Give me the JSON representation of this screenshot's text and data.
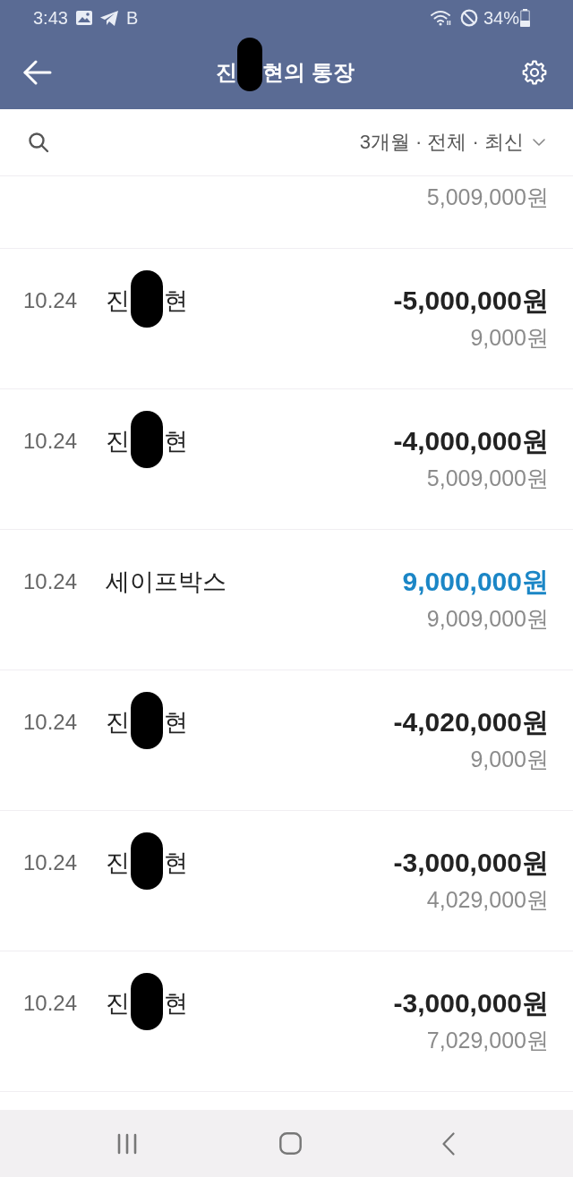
{
  "status_bar": {
    "time": "3:43",
    "notification_letter": "B",
    "battery_text": "34%"
  },
  "header": {
    "title_parts": [
      "진",
      "현의 통장"
    ]
  },
  "filter": {
    "label": "3개월 · 전체 · 최신"
  },
  "partial_row": {
    "balance": "5,009,000원"
  },
  "transactions": [
    {
      "kind": "withdrawal",
      "date": "10.24",
      "name_parts": [
        "진",
        "현"
      ],
      "amount": "-5,000,000원",
      "balance": "9,000원"
    },
    {
      "kind": "withdrawal",
      "date": "10.24",
      "name_parts": [
        "진",
        "현"
      ],
      "amount": "-4,000,000원",
      "balance": "5,009,000원"
    },
    {
      "kind": "deposit",
      "date": "10.24",
      "name_parts": [
        "세이프박스"
      ],
      "amount": "9,000,000원",
      "balance": "9,009,000원"
    },
    {
      "kind": "withdrawal",
      "date": "10.24",
      "name_parts": [
        "진",
        "현"
      ],
      "amount": "-4,020,000원",
      "balance": "9,000원"
    },
    {
      "kind": "withdrawal",
      "date": "10.24",
      "name_parts": [
        "진",
        "현"
      ],
      "amount": "-3,000,000원",
      "balance": "4,029,000원"
    },
    {
      "kind": "withdrawal",
      "date": "10.24",
      "name_parts": [
        "진",
        "현"
      ],
      "amount": "-3,000,000원",
      "balance": "7,029,000원"
    }
  ]
}
